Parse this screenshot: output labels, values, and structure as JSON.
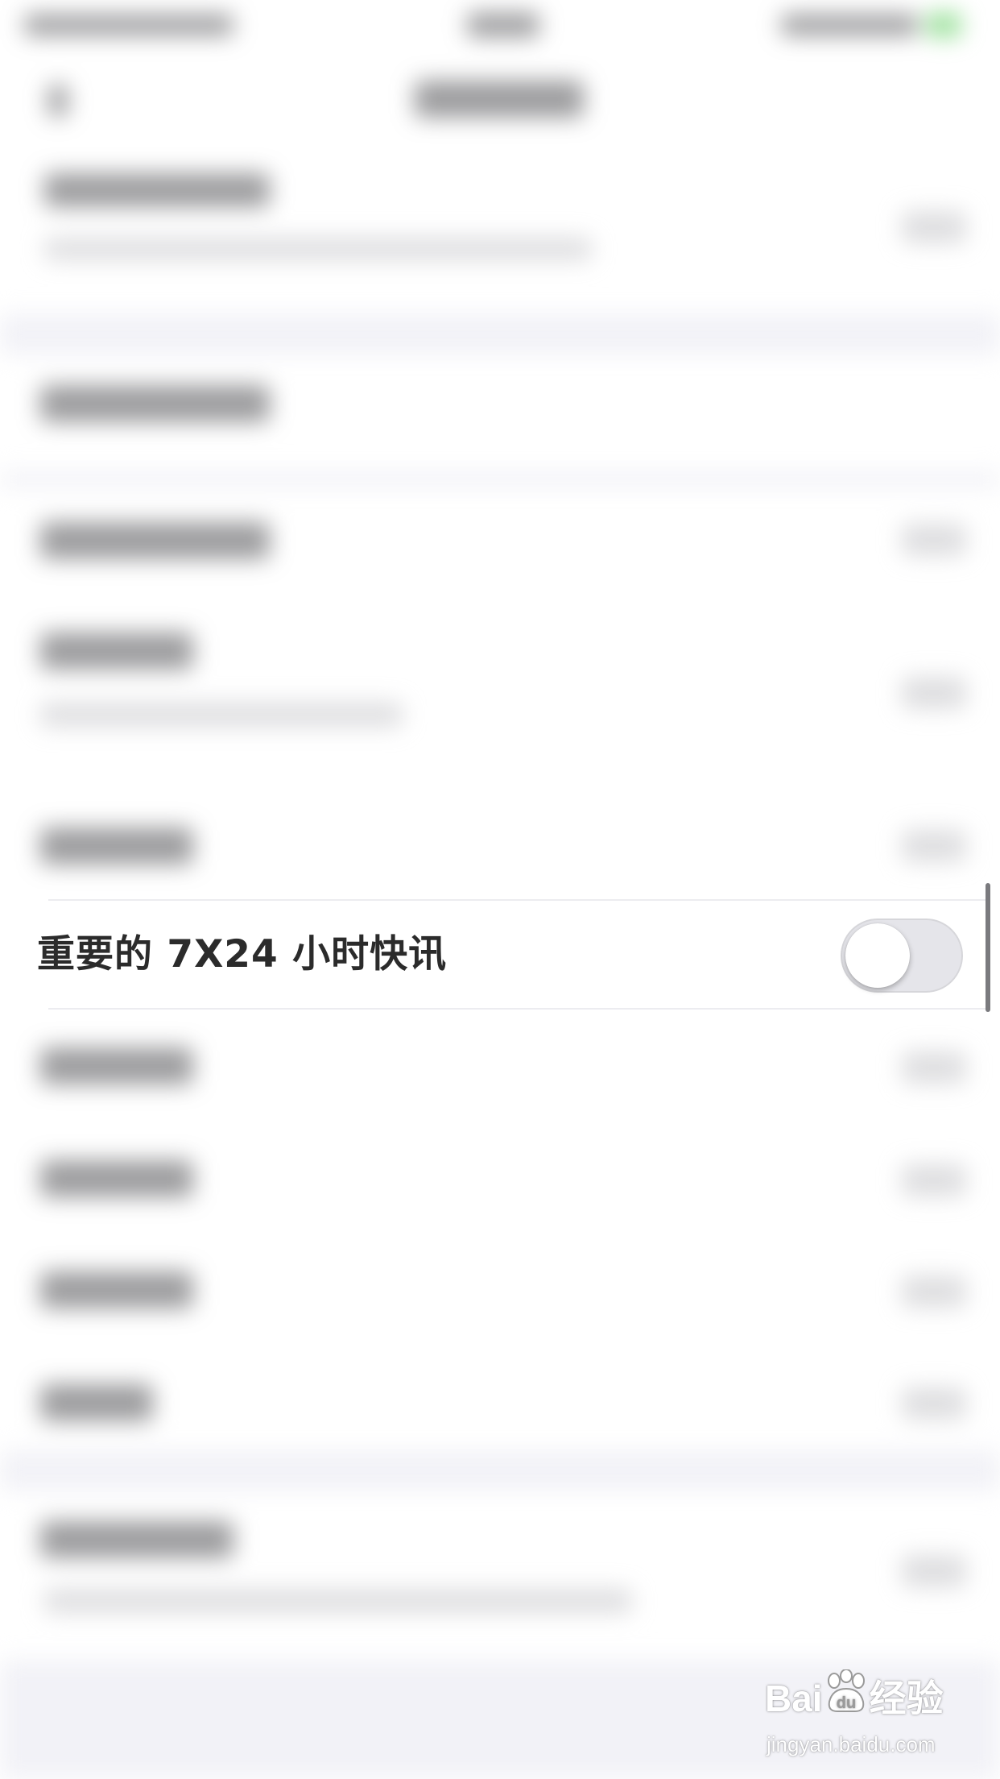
{
  "setting_row": {
    "label": "重要的 7X24 小时快讯",
    "toggle_on": false
  },
  "watermark": {
    "logo_text": "Bai",
    "logo_text_2": "经验",
    "url": "jingyan.baidu.com"
  },
  "colors": {
    "label_text": "#2b2b2b",
    "toggle_off_track": "#e5e5ea",
    "separator": "#ececf0",
    "background": "#ffffff"
  },
  "icons": {
    "toggle": "switch-off",
    "watermark_paw": "baidu-paw-icon"
  }
}
